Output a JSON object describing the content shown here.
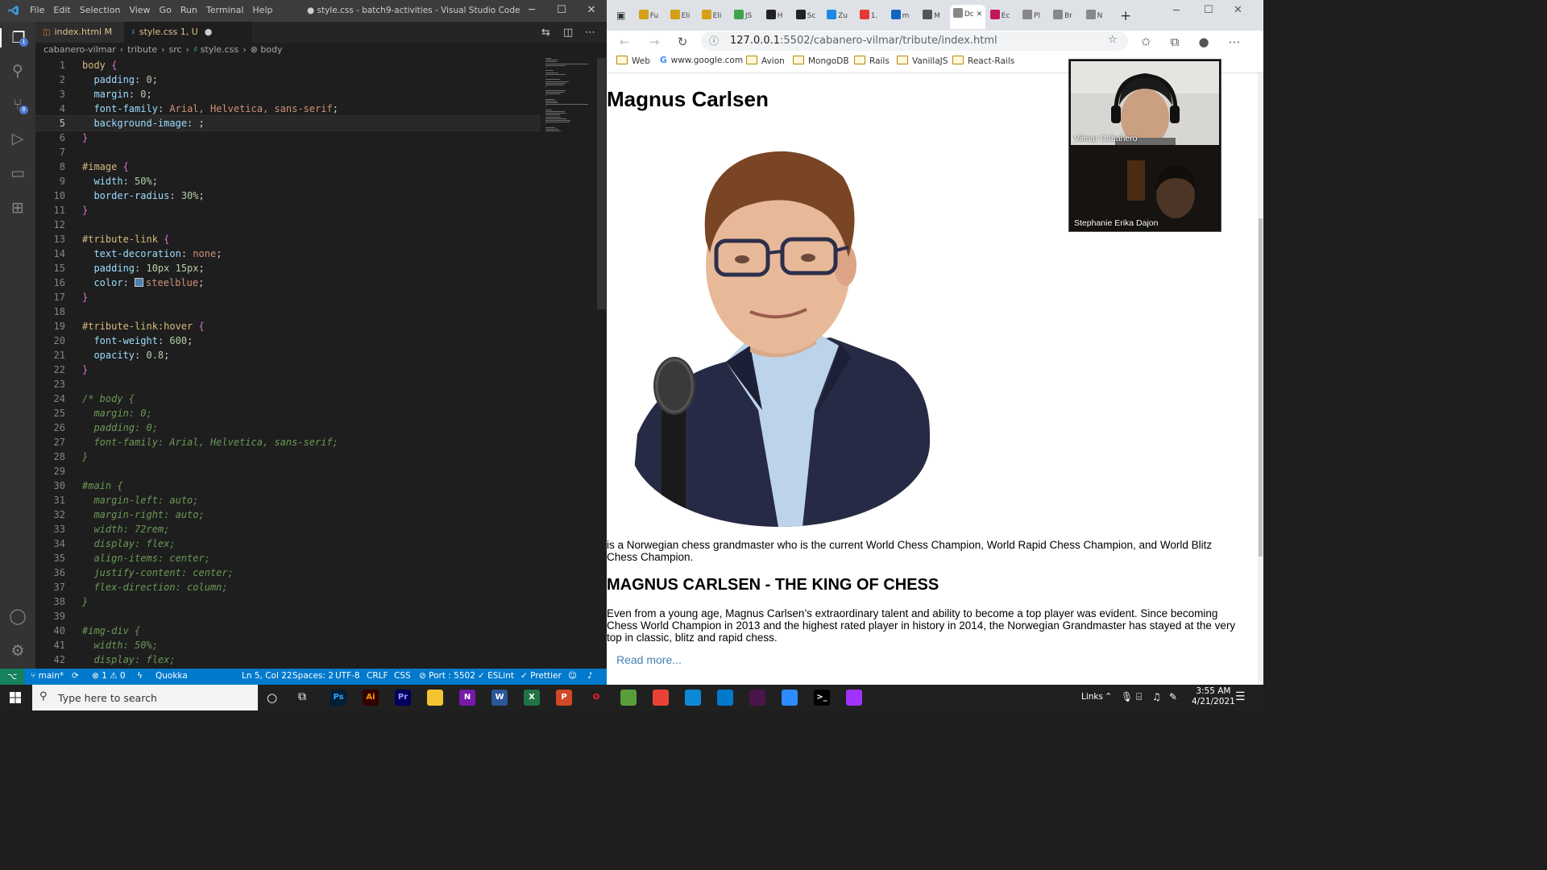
{
  "vscode": {
    "window_title": "● style.css - batch9-activities - Visual Studio Code",
    "menu": [
      "File",
      "Edit",
      "Selection",
      "View",
      "Go",
      "Run",
      "Terminal",
      "Help"
    ],
    "tabs": [
      {
        "label": "index.html",
        "status": "M"
      },
      {
        "label": "style.css",
        "status": "1, U"
      }
    ],
    "breadcrumb": [
      "cabanero-vilmar",
      "tribute",
      "src",
      "style.css",
      "body"
    ],
    "code_lines": [
      [
        [
          "sel",
          "body"
        ],
        [
          "txt",
          " "
        ],
        [
          "brk",
          "{"
        ]
      ],
      [
        [
          "txt",
          "  "
        ],
        [
          "prop",
          "padding"
        ],
        [
          "txt",
          ": "
        ],
        [
          "num",
          "0"
        ],
        [
          "txt",
          ";"
        ]
      ],
      [
        [
          "txt",
          "  "
        ],
        [
          "prop",
          "margin"
        ],
        [
          "txt",
          ": "
        ],
        [
          "num",
          "0"
        ],
        [
          "txt",
          ";"
        ]
      ],
      [
        [
          "txt",
          "  "
        ],
        [
          "prop",
          "font-family"
        ],
        [
          "txt",
          ": "
        ],
        [
          "val",
          "Arial, Helvetica, sans-serif"
        ],
        [
          "txt",
          ";"
        ]
      ],
      [
        [
          "txt",
          "  "
        ],
        [
          "prop",
          "background-image"
        ],
        [
          "txt",
          ": ;"
        ]
      ],
      [
        [
          "brk",
          "}"
        ]
      ],
      [],
      [
        [
          "sel",
          "#image"
        ],
        [
          "txt",
          " "
        ],
        [
          "brk",
          "{"
        ]
      ],
      [
        [
          "txt",
          "  "
        ],
        [
          "prop",
          "width"
        ],
        [
          "txt",
          ": "
        ],
        [
          "num",
          "50%"
        ],
        [
          "txt",
          ";"
        ]
      ],
      [
        [
          "txt",
          "  "
        ],
        [
          "prop",
          "border-radius"
        ],
        [
          "txt",
          ": "
        ],
        [
          "num",
          "30%"
        ],
        [
          "txt",
          ";"
        ]
      ],
      [
        [
          "brk",
          "}"
        ]
      ],
      [],
      [
        [
          "sel",
          "#tribute-link"
        ],
        [
          "txt",
          " "
        ],
        [
          "brk",
          "{"
        ]
      ],
      [
        [
          "txt",
          "  "
        ],
        [
          "prop",
          "text-decoration"
        ],
        [
          "txt",
          ": "
        ],
        [
          "val",
          "none"
        ],
        [
          "txt",
          ";"
        ]
      ],
      [
        [
          "txt",
          "  "
        ],
        [
          "prop",
          "padding"
        ],
        [
          "txt",
          ": "
        ],
        [
          "num",
          "10px 15px"
        ],
        [
          "txt",
          ";"
        ]
      ],
      [
        [
          "txt",
          "  "
        ],
        [
          "prop",
          "color"
        ],
        [
          "txt",
          ": "
        ],
        [
          "swatch",
          ""
        ],
        [
          "val",
          "steelblue"
        ],
        [
          "txt",
          ";"
        ]
      ],
      [
        [
          "brk",
          "}"
        ]
      ],
      [],
      [
        [
          "sel",
          "#tribute-link:hover"
        ],
        [
          "txt",
          " "
        ],
        [
          "brk",
          "{"
        ]
      ],
      [
        [
          "txt",
          "  "
        ],
        [
          "prop",
          "font-weight"
        ],
        [
          "txt",
          ": "
        ],
        [
          "num",
          "600"
        ],
        [
          "txt",
          ";"
        ]
      ],
      [
        [
          "txt",
          "  "
        ],
        [
          "prop",
          "opacity"
        ],
        [
          "txt",
          ": "
        ],
        [
          "num",
          "0.8"
        ],
        [
          "txt",
          ";"
        ]
      ],
      [
        [
          "brk",
          "}"
        ]
      ],
      [],
      [
        [
          "cmt",
          "/* body {"
        ]
      ],
      [
        [
          "cmt",
          "  margin: 0;"
        ]
      ],
      [
        [
          "cmt",
          "  padding: 0;"
        ]
      ],
      [
        [
          "cmt",
          "  font-family: Arial, Helvetica, sans-serif;"
        ]
      ],
      [
        [
          "cmt",
          "}"
        ]
      ],
      [],
      [
        [
          "cmt",
          "#main {"
        ]
      ],
      [
        [
          "cmt",
          "  margin-left: auto;"
        ]
      ],
      [
        [
          "cmt",
          "  margin-right: auto;"
        ]
      ],
      [
        [
          "cmt",
          "  width: 72rem;"
        ]
      ],
      [
        [
          "cmt",
          "  display: flex;"
        ]
      ],
      [
        [
          "cmt",
          "  align-items: center;"
        ]
      ],
      [
        [
          "cmt",
          "  justify-content: center;"
        ]
      ],
      [
        [
          "cmt",
          "  flex-direction: column;"
        ]
      ],
      [
        [
          "cmt",
          "}"
        ]
      ],
      [],
      [
        [
          "cmt",
          "#img-div {"
        ]
      ],
      [
        [
          "cmt",
          "  width: 50%;"
        ]
      ],
      [
        [
          "cmt",
          "  display: flex;"
        ]
      ]
    ],
    "current_line": 5,
    "status": {
      "branch": "main*",
      "problems": "⊗ 1 ⚠ 0",
      "quokka": "Quokka",
      "position": "Ln 5, Col 22",
      "spaces": "Spaces: 2",
      "encoding": "UTF-8",
      "eol": "CRLF",
      "language": "CSS",
      "port": "⊘ Port : 5502",
      "eslint": "✓ ESLint",
      "prettier": "✓ Prettier"
    },
    "activity_badges": {
      "explorer": "1",
      "scm": "8"
    }
  },
  "browser": {
    "tabs": [
      {
        "label": "Fu",
        "color": "#d4a017"
      },
      {
        "label": "Eli",
        "color": "#d4a017"
      },
      {
        "label": "Eli",
        "color": "#d4a017"
      },
      {
        "label": "JS",
        "color": "#3fa34d"
      },
      {
        "label": "H",
        "color": "#222222"
      },
      {
        "label": "Sc",
        "color": "#222222"
      },
      {
        "label": "Zu",
        "color": "#1e88e5"
      },
      {
        "label": "1.",
        "color": "#e53935"
      },
      {
        "label": "m",
        "color": "#1565c0"
      },
      {
        "label": "M",
        "color": "#555555"
      },
      {
        "label": "Dc",
        "color": "#888888"
      },
      {
        "label": "Ec",
        "color": "#c2185b"
      },
      {
        "label": "Pl",
        "color": "#888888"
      },
      {
        "label": "Br",
        "color": "#888888"
      },
      {
        "label": "N",
        "color": "#888888"
      }
    ],
    "url": "127.0.0.1",
    "url_rest": ":5502/cabanero-vilmar/tribute/index.html",
    "bookmarks": [
      "Web",
      "www.google.com",
      "Avion",
      "MongoDB",
      "Rails",
      "VanillaJS",
      "React-Rails"
    ],
    "page": {
      "title": "Magnus Carlsen",
      "intro": "is a Norwegian chess grandmaster who is the current World Chess Champion, World Rapid Chess Champion, and World Blitz Chess Champion.",
      "heading": "MAGNUS CARLSEN - THE KING OF CHESS",
      "body": "Even from a young age, Magnus Carlsen’s extraordinary talent and ability to become a top player was evident. Since becoming Chess World Champion in 2013 and the highest rated player in history in 2014, the Norwegian Grandmaster has stayed at the very top in classic, blitz and rapid chess.",
      "link": "Read more..."
    }
  },
  "video_call": {
    "participants": [
      "Vilmar Cabañero",
      "Stephanie Erika Dajon"
    ]
  },
  "taskbar": {
    "search_placeholder": "Type here to search",
    "apps": [
      {
        "label": "Ps",
        "bg": "#001e36",
        "fg": "#31a8ff"
      },
      {
        "label": "Ai",
        "bg": "#330000",
        "fg": "#ff9a00"
      },
      {
        "label": "Pr",
        "bg": "#00005b",
        "fg": "#9999ff"
      },
      {
        "label": "",
        "bg": "#f4c430",
        "fg": "#000000"
      },
      {
        "label": "N",
        "bg": "#7719aa",
        "fg": "#ffffff"
      },
      {
        "label": "W",
        "bg": "#2b579a",
        "fg": "#ffffff"
      },
      {
        "label": "X",
        "bg": "#217346",
        "fg": "#ffffff"
      },
      {
        "label": "P",
        "bg": "#d24726",
        "fg": "#ffffff"
      },
      {
        "label": "O",
        "bg": "#202020",
        "fg": "#ff1b2d"
      },
      {
        "label": "",
        "bg": "#5a9e3c",
        "fg": "#ffffff"
      },
      {
        "label": "",
        "bg": "#ea4335",
        "fg": "#ffffff"
      },
      {
        "label": "",
        "bg": "#0c8ad6",
        "fg": "#ffffff"
      },
      {
        "label": "",
        "bg": "#007acc",
        "fg": "#ffffff"
      },
      {
        "label": "",
        "bg": "#4a154b",
        "fg": "#ffffff"
      },
      {
        "label": "",
        "bg": "#2d8cff",
        "fg": "#ffffff"
      },
      {
        "label": ">_",
        "bg": "#000000",
        "fg": "#ffffff"
      },
      {
        "label": "",
        "bg": "#a033ff",
        "fg": "#ffffff"
      }
    ],
    "links": "Links",
    "time": "3:55 AM",
    "date": "4/21/2021"
  }
}
